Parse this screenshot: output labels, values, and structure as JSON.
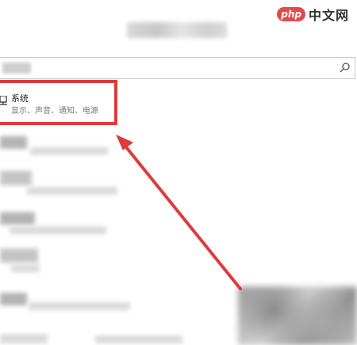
{
  "watermark": {
    "badge": "php",
    "text": "中文网"
  },
  "search": {
    "icon": "search-icon"
  },
  "settings": {
    "system": {
      "title": "系统",
      "subtitle": "显示、声音、通知、电源",
      "icon": "monitor-icon"
    }
  },
  "annotation": {
    "highlight_color": "#dd3b3b",
    "arrow_color": "#dd3b3b"
  }
}
